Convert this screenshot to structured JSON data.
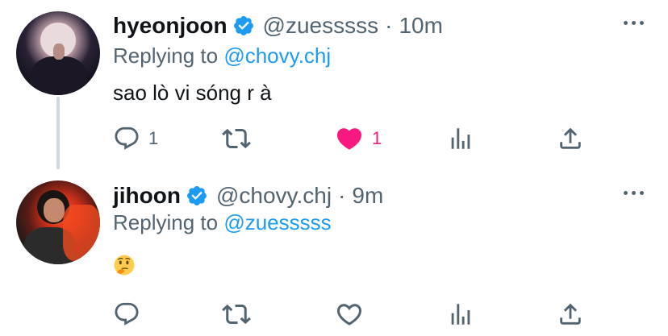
{
  "tweets": [
    {
      "display_name": "hyeonjoon",
      "handle": "@zuesssss",
      "separator": "·",
      "time": "10m",
      "replying_prefix": "Replying to ",
      "replying_to": "@chovy.chj",
      "text": "sao lò vi sóng r à",
      "reply_count": "1",
      "like_count": "1",
      "liked": true
    },
    {
      "display_name": "jihoon",
      "handle": "@chovy.chj",
      "separator": "·",
      "time": "9m",
      "replying_prefix": "Replying to ",
      "replying_to": "@zuesssss",
      "emoji": "thinking-face",
      "reply_count": "",
      "like_count": "",
      "liked": false
    }
  ],
  "colors": {
    "verified": "#1d9bf0",
    "mention": "#1d9bf0",
    "like": "#f91880",
    "icon_gray": "#536471"
  }
}
